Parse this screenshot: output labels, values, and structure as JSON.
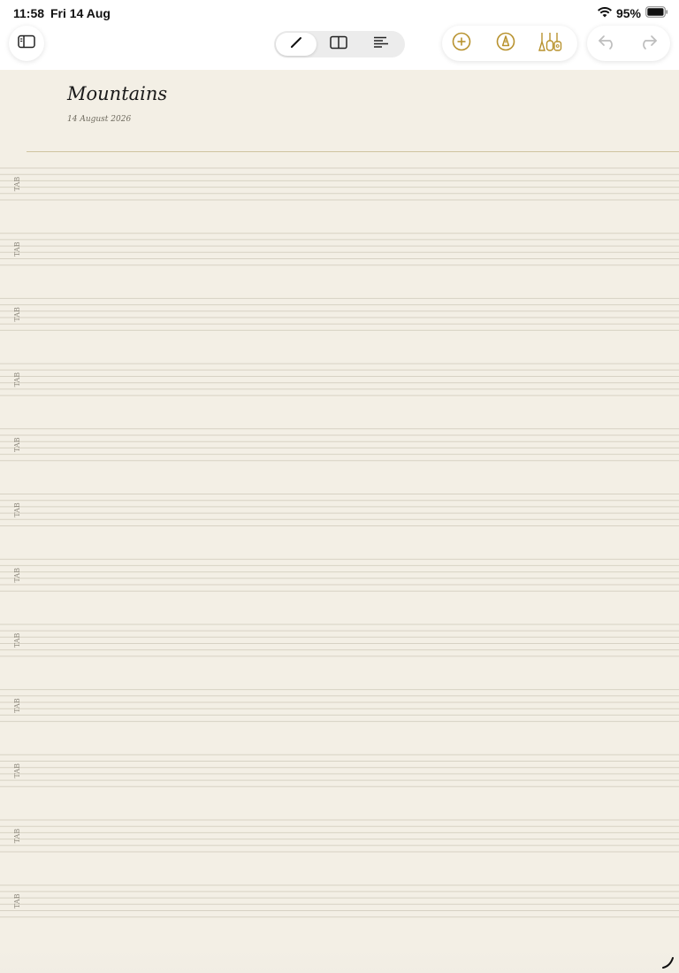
{
  "status_bar": {
    "time": "11:58",
    "date": "Fri 14 Aug",
    "battery": "95%",
    "icons": [
      "wifi-icon",
      "battery-icon"
    ]
  },
  "toolbar": {
    "left": {
      "icon": "sidebar-icon"
    },
    "modes": [
      {
        "icon": "pencil-icon",
        "active": true
      },
      {
        "icon": "split-view-icon",
        "active": false
      },
      {
        "icon": "text-align-icon",
        "active": false
      }
    ],
    "tools": [
      {
        "icon": "add-circle-icon"
      },
      {
        "icon": "pen-circle-icon"
      },
      {
        "icon": "instruments-icon"
      }
    ],
    "history": [
      {
        "icon": "undo-icon"
      },
      {
        "icon": "redo-icon"
      }
    ],
    "accent_color": "#b8922e"
  },
  "document": {
    "title": "Mountains",
    "date": "14 August 2026",
    "staff_label": "TAB",
    "staff_count": 12
  }
}
